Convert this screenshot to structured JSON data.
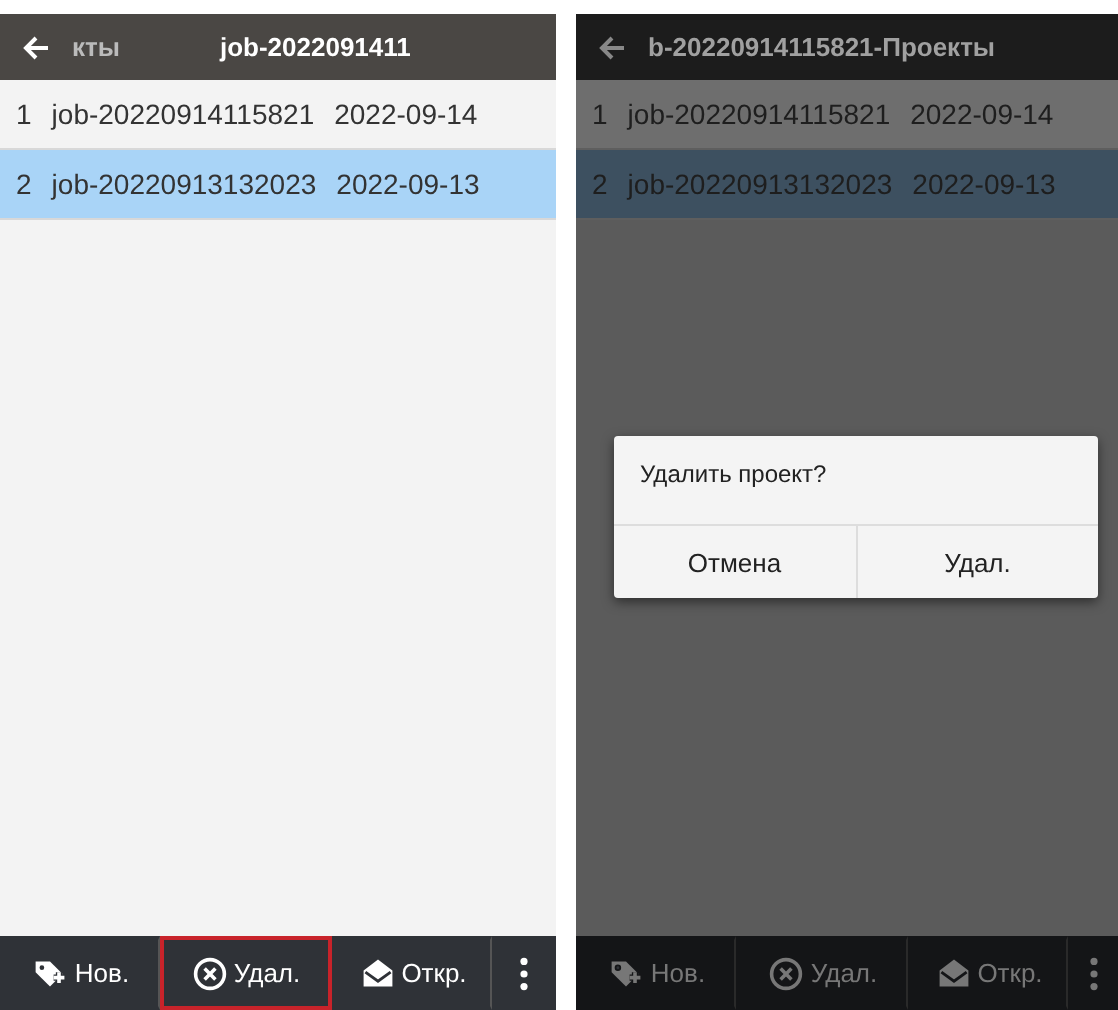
{
  "screens": [
    {
      "dimmed": false,
      "header": {
        "texts": [
          "кты",
          "job-2022091411"
        ]
      },
      "rows": [
        {
          "index": "1",
          "name": "job-20220914115821",
          "date": "2022-09-14",
          "selected": false
        },
        {
          "index": "2",
          "name": "job-20220913132023",
          "date": "2022-09-13",
          "selected": true
        }
      ],
      "toolbar": [
        {
          "kind": "new",
          "label": "Нов.",
          "highlighted": false
        },
        {
          "kind": "delete",
          "label": "Удал.",
          "highlighted": true
        },
        {
          "kind": "open",
          "label": "Откр.",
          "highlighted": false
        },
        {
          "kind": "more",
          "highlighted": false
        }
      ]
    },
    {
      "dimmed": true,
      "header": {
        "texts": [
          "b-20220914115821-Проекты"
        ]
      },
      "rows": [
        {
          "index": "1",
          "name": "job-20220914115821",
          "date": "2022-09-14",
          "selected": false
        },
        {
          "index": "2",
          "name": "job-20220913132023",
          "date": "2022-09-13",
          "selected": true
        }
      ],
      "toolbar": [
        {
          "kind": "new",
          "label": "Нов.",
          "highlighted": false
        },
        {
          "kind": "delete",
          "label": "Удал.",
          "highlighted": false
        },
        {
          "kind": "open",
          "label": "Откр.",
          "highlighted": false
        },
        {
          "kind": "more",
          "highlighted": false
        }
      ],
      "dialog": {
        "message": "Удалить проект?",
        "buttons": [
          "Отмена",
          "Удал."
        ]
      }
    }
  ]
}
